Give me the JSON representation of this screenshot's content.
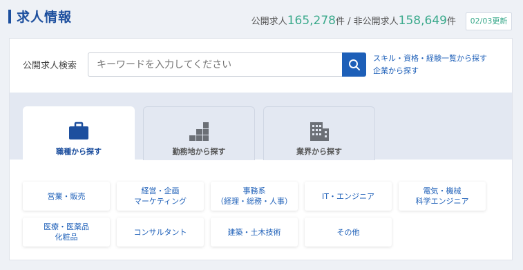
{
  "header": {
    "title": "求人情報",
    "public_label": "公開求人",
    "public_count": "165,278",
    "unit1": "件 / ",
    "private_label": "非公開求人",
    "private_count": "158,649",
    "unit2": "件",
    "update": "02/03更新"
  },
  "search": {
    "label": "公開求人検索",
    "placeholder": "キーワードを入力してください",
    "link_skills": "スキル・資格・経験一覧から探す",
    "link_company": "企業から探す"
  },
  "tabs": [
    {
      "label": "職種から探す",
      "icon": "briefcase-icon",
      "active": true
    },
    {
      "label": "勤務地から探す",
      "icon": "location-blocks-icon",
      "active": false
    },
    {
      "label": "業界から探す",
      "icon": "building-icon",
      "active": false
    }
  ],
  "categories": [
    "営業・販売",
    "経営・企画\nマーケティング",
    "事務系\n（経理・総務・人事）",
    "IT・エンジニア",
    "電気・機械\n科学エンジニア",
    "医療・医薬品\n化粧品",
    "コンサルタント",
    "建築・土木技術",
    "その他"
  ],
  "colors": {
    "brand": "#1d4f9e",
    "button": "#1d5fb8",
    "count": "#3aa98b"
  }
}
